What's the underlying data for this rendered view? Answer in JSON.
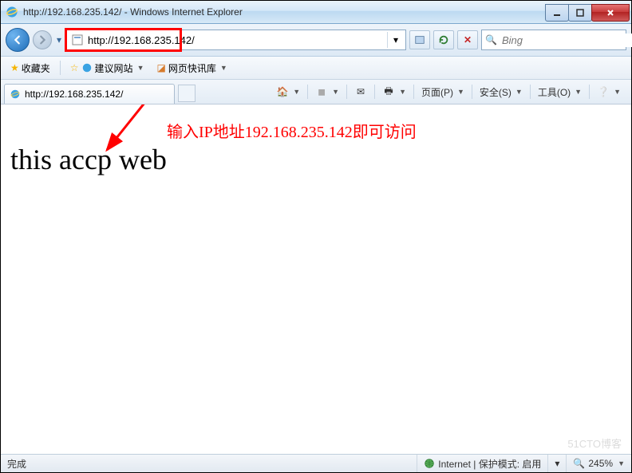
{
  "titlebar": {
    "title": "http://192.168.235.142/ - Windows Internet Explorer"
  },
  "nav": {
    "url": "http://192.168.235.142/",
    "search_placeholder": "Bing"
  },
  "favbar": {
    "favorites": "收藏夹",
    "suggested": "建议网站",
    "slice": "网页快讯库"
  },
  "tab": {
    "label": "http://192.168.235.142/"
  },
  "cmdbar": {
    "page": "页面(P)",
    "safety": "安全(S)",
    "tools": "工具(O)"
  },
  "page": {
    "body_text": "this accp web",
    "annotation": "输入IP地址192.168.235.142即可访问",
    "watermark": "51CTO博客"
  },
  "status": {
    "done": "完成",
    "zone": "Internet | 保护模式: 启用",
    "zoom": "245%"
  }
}
